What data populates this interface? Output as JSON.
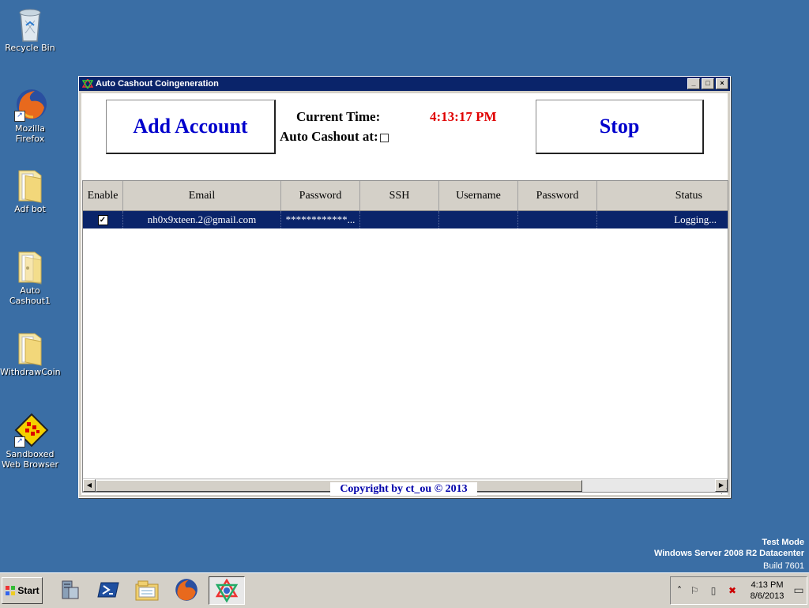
{
  "desktop": {
    "icons": [
      {
        "label": "Recycle Bin"
      },
      {
        "label": "Mozilla Firefox"
      },
      {
        "label": "Adf bot"
      },
      {
        "label": "Auto Cashout1"
      },
      {
        "label": "WithdrawCoin"
      },
      {
        "label": "Sandboxed Web Browser"
      }
    ]
  },
  "window": {
    "title": "Auto Cashout Coingeneration",
    "add_account_label": "Add Account",
    "stop_label": "Stop",
    "current_time_label": "Current Time:",
    "current_time_value": "4:13:17 PM",
    "auto_cashout_label": "Auto Cashout at:",
    "auto_cashout_checked": false,
    "copyright": "Copyright by ct_ou ©  2013"
  },
  "grid": {
    "columns": [
      "Enable",
      "Email",
      "Password",
      "SSH",
      "Username",
      "Password",
      "Status"
    ],
    "rows": [
      {
        "enable": true,
        "email": "nh0x9xteen.2@gmail.com",
        "password": "************...",
        "ssh": "",
        "username": "",
        "password2": "",
        "status": "Logging..."
      }
    ]
  },
  "watermark": {
    "line1": "Test Mode",
    "line2": "Windows Server 2008 R2 Datacenter",
    "line3": "Build 7601"
  },
  "taskbar": {
    "start_label": "Start",
    "clock_time": "4:13 PM",
    "clock_date": "8/6/2013"
  },
  "colors": {
    "desktop": "#3a6ea5",
    "titlebar": "#0a246a",
    "selection": "#0a246a",
    "button_text": "#0000cc",
    "time_text": "#e00000"
  },
  "icons": {
    "recycle_bin": "recycle-bin-icon",
    "firefox": "firefox-icon",
    "folder": "folder-icon",
    "sandbox": "sandboxie-icon",
    "server_manager": "server-manager-icon",
    "powershell": "powershell-icon",
    "explorer": "explorer-icon",
    "app": "star-of-david-icon"
  }
}
